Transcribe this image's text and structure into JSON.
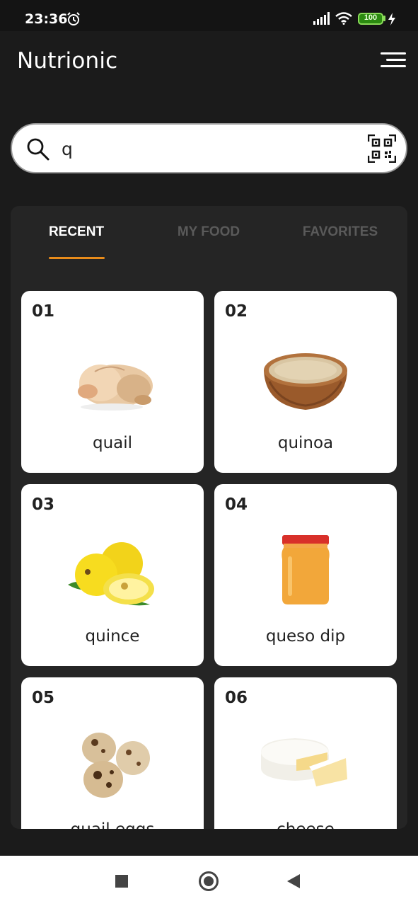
{
  "status_bar": {
    "time": "23:36",
    "battery": "100",
    "icons": [
      "alarm-icon",
      "signal-icon",
      "wifi-icon",
      "battery-icon",
      "charging-bolt-icon"
    ]
  },
  "header": {
    "title": "Nutrionic",
    "menu_icon": "hamburger-menu-icon"
  },
  "search": {
    "value": "q",
    "placeholder": "",
    "search_icon": "search-icon",
    "scan_icon": "qr-code-icon"
  },
  "tabs": [
    {
      "label": "RECENT",
      "active": true
    },
    {
      "label": "MY FOOD",
      "active": false
    },
    {
      "label": "FAVORITES",
      "active": false
    }
  ],
  "foods": [
    {
      "number": "01",
      "name": "quail",
      "image": "quail-image"
    },
    {
      "number": "02",
      "name": "quinoa",
      "image": "quinoa-image"
    },
    {
      "number": "03",
      "name": "quince",
      "image": "quince-image"
    },
    {
      "number": "04",
      "name": "queso dip",
      "image": "queso-dip-image"
    },
    {
      "number": "05",
      "name": "quail eggs",
      "image": "quail-eggs-image"
    },
    {
      "number": "06",
      "name": "cheese",
      "image": "cheese-image"
    }
  ],
  "colors": {
    "background": "#1b1b1b",
    "panel": "#252525",
    "accent": "#e88b1a",
    "inactive_tab": "#5a5a5a"
  },
  "nav_bar": {
    "icons": [
      "recents-square-icon",
      "home-circle-icon",
      "back-triangle-icon"
    ]
  }
}
